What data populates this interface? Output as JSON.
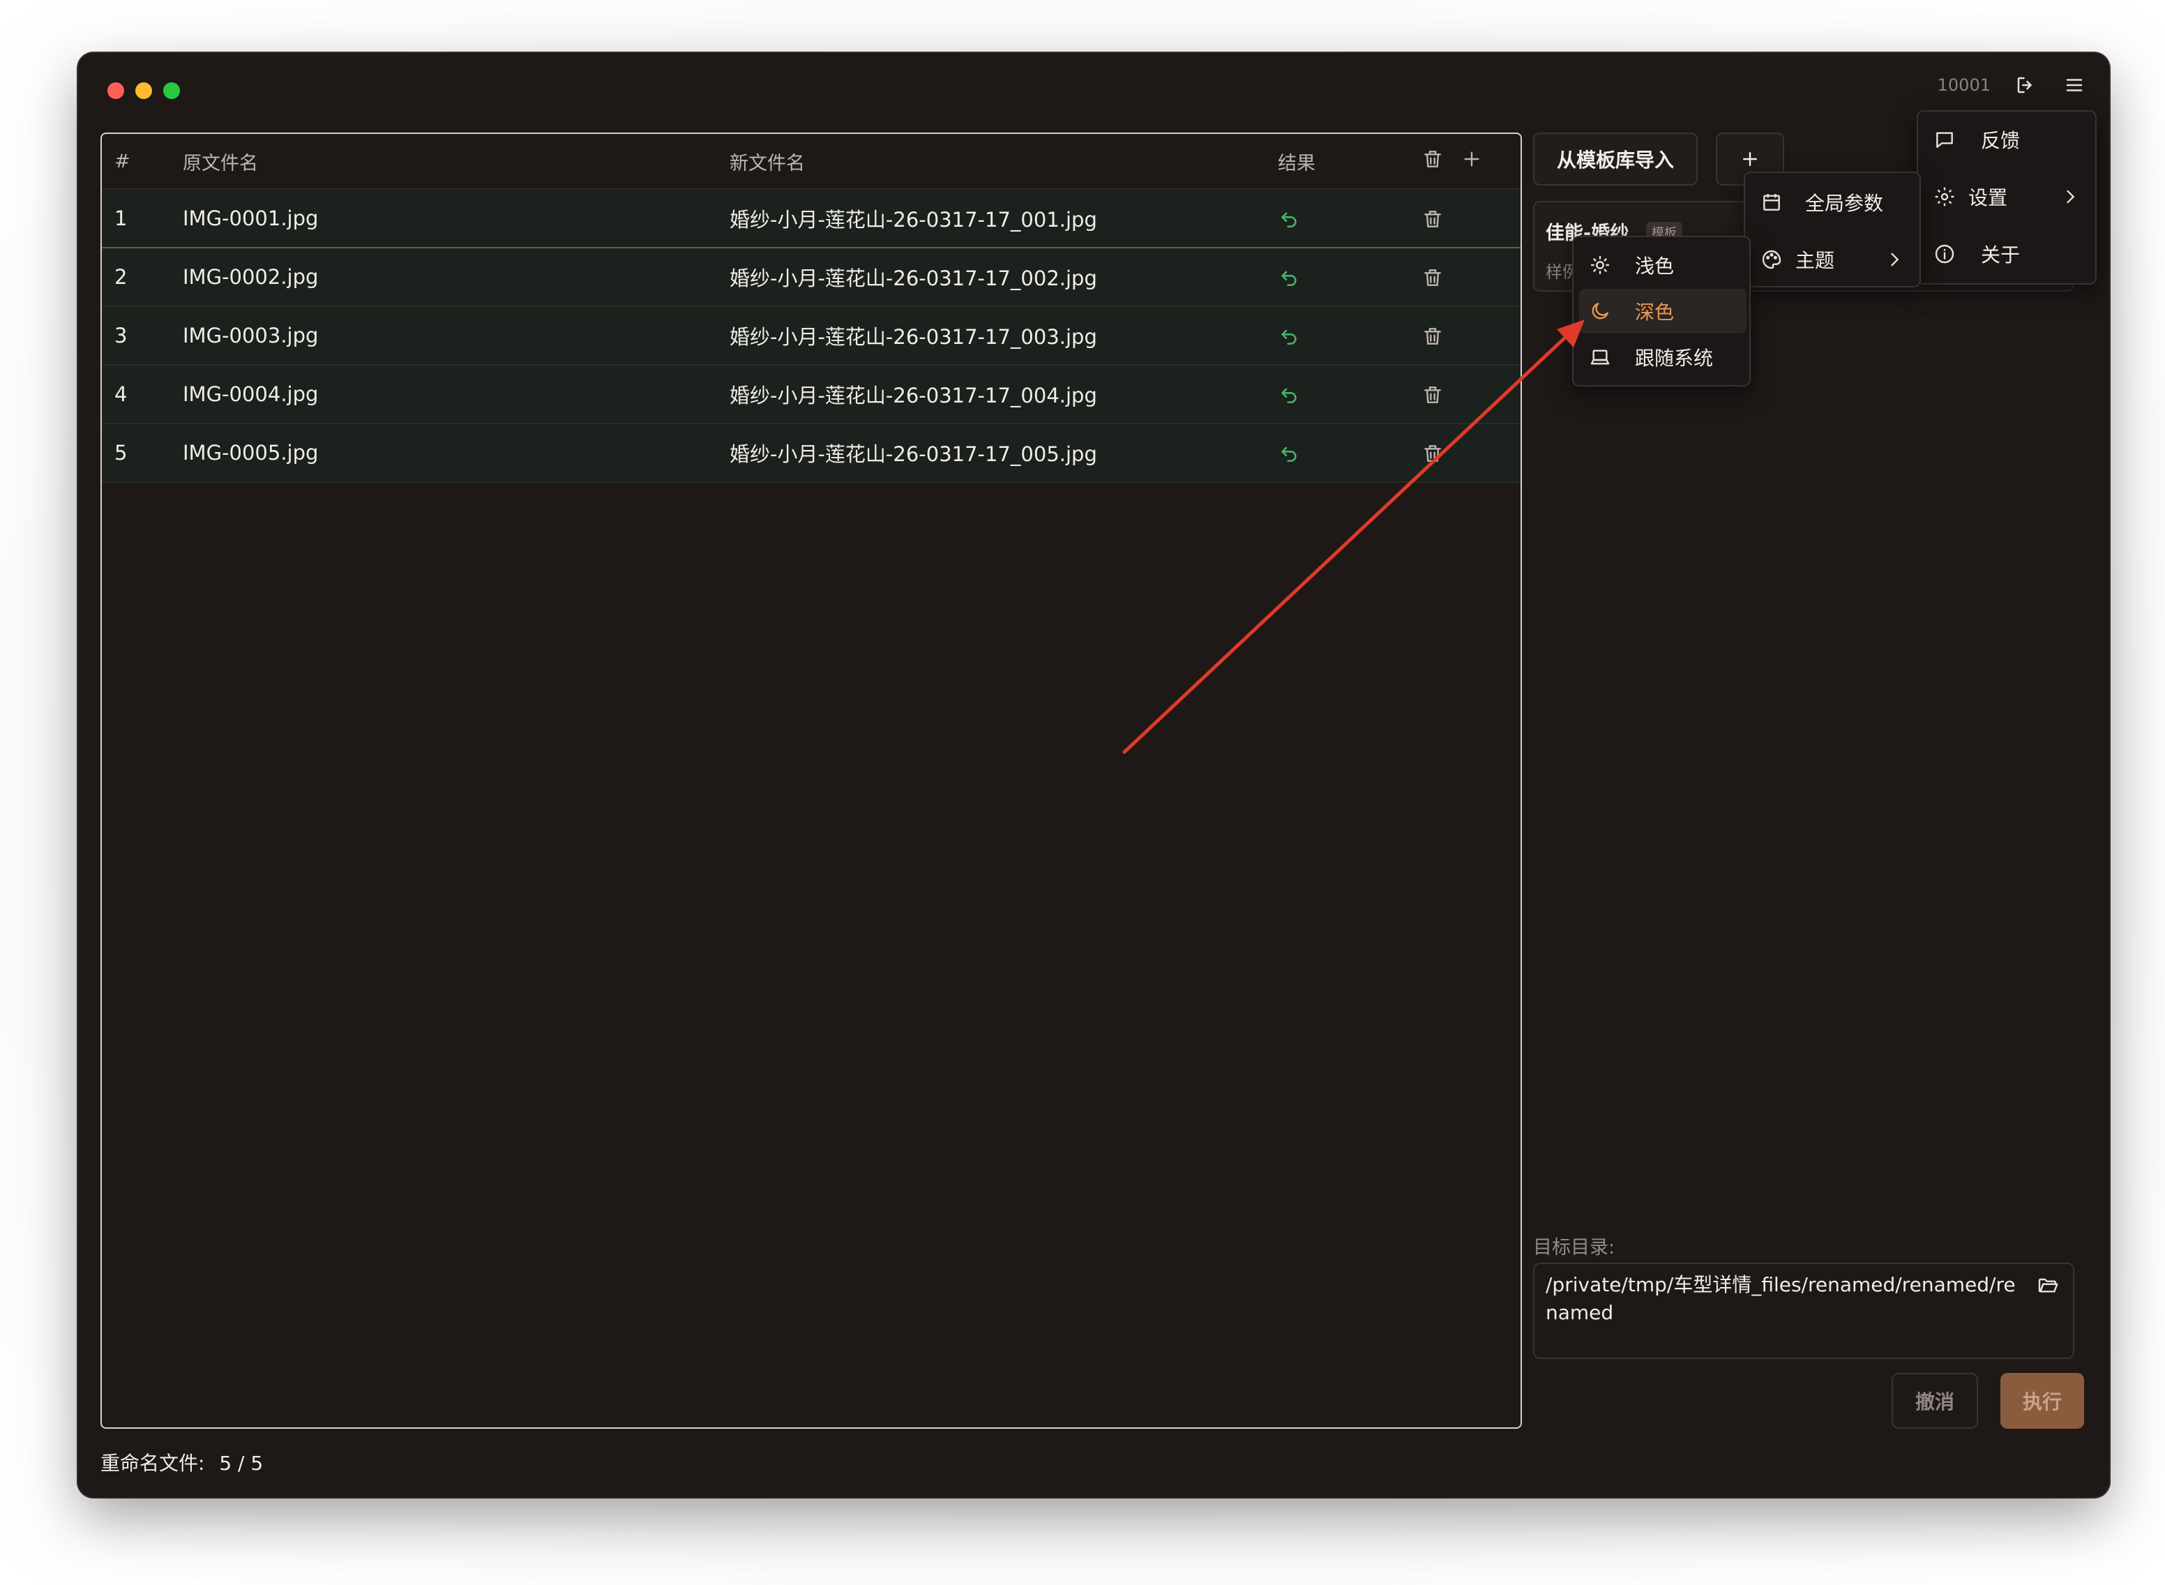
{
  "app": {
    "user_id": "10001",
    "icons": [
      "logout-icon",
      "hamburger-menu-icon"
    ]
  },
  "table": {
    "headers": {
      "index": "#",
      "original": "原文件名",
      "new": "新文件名",
      "result": "结果"
    },
    "rows": [
      {
        "index": "1",
        "original": "IMG-0001.jpg",
        "new": "婚纱-小月-莲花山-26-0317-17_001.jpg"
      },
      {
        "index": "2",
        "original": "IMG-0002.jpg",
        "new": "婚纱-小月-莲花山-26-0317-17_002.jpg"
      },
      {
        "index": "3",
        "original": "IMG-0003.jpg",
        "new": "婚纱-小月-莲花山-26-0317-17_003.jpg"
      },
      {
        "index": "4",
        "original": "IMG-0004.jpg",
        "new": "婚纱-小月-莲花山-26-0317-17_004.jpg"
      },
      {
        "index": "5",
        "original": "IMG-0005.jpg",
        "new": "婚纱-小月-莲花山-26-0317-17_005.jpg"
      }
    ]
  },
  "panel": {
    "import_label": "从模板库导入",
    "template": {
      "name": "佳能-婚纱",
      "tag": "模板",
      "sub": "样例"
    },
    "target_label": "目标目录:",
    "target_path": "/private/tmp/车型详情_files/renamed/renamed/renamed",
    "cancel_label": "撤消",
    "execute_label": "执行"
  },
  "footer": {
    "label": "重命名文件:",
    "count": "5 / 5"
  },
  "main_menu": {
    "feedback": "反馈",
    "settings": "设置",
    "about": "关于"
  },
  "settings_menu": {
    "global_params": "全局参数",
    "theme": "主题"
  },
  "theme_menu": {
    "light": "浅色",
    "dark": "深色",
    "system": "跟随系统",
    "selected": "深色"
  },
  "colors": {
    "accent": "#e79955",
    "result_icon": "#4caf6a",
    "annotation_arrow": "#e03a2a",
    "window_bg": "#1e1817"
  }
}
